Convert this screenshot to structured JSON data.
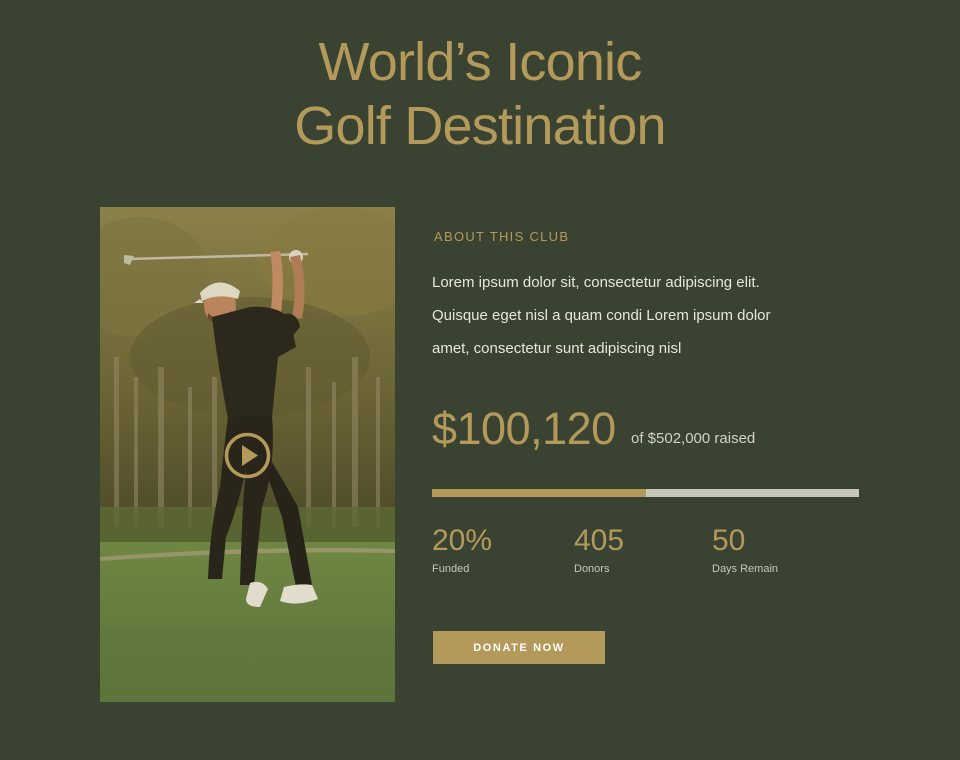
{
  "heading": {
    "line1": "World’s Iconic",
    "line2": "Golf Destination"
  },
  "media": {
    "image": "golfer-swing-photo",
    "play_icon": "play-circle-icon"
  },
  "about": {
    "eyebrow": "ABOUT THIS CLUB",
    "line1": "Lorem ipsum dolor sit, consectetur adipiscing elit.",
    "line2": "Quisque eget nisl a quam condi Lorem ipsum dolor",
    "line3": "amet, consectetur sunt adipiscing nisl"
  },
  "funding": {
    "amount": "$100,120",
    "raised_text": "of $502,000 raised",
    "progress_fraction": 0.5
  },
  "stats": [
    {
      "value": "20%",
      "label": "Funded"
    },
    {
      "value": "405",
      "label": "Donors"
    },
    {
      "value": "50",
      "label": "Days Remain"
    }
  ],
  "cta": {
    "label": "DONATE NOW"
  },
  "colors": {
    "background": "#3a4332",
    "accent": "#b49a5a",
    "track": "#c6c6bd"
  }
}
